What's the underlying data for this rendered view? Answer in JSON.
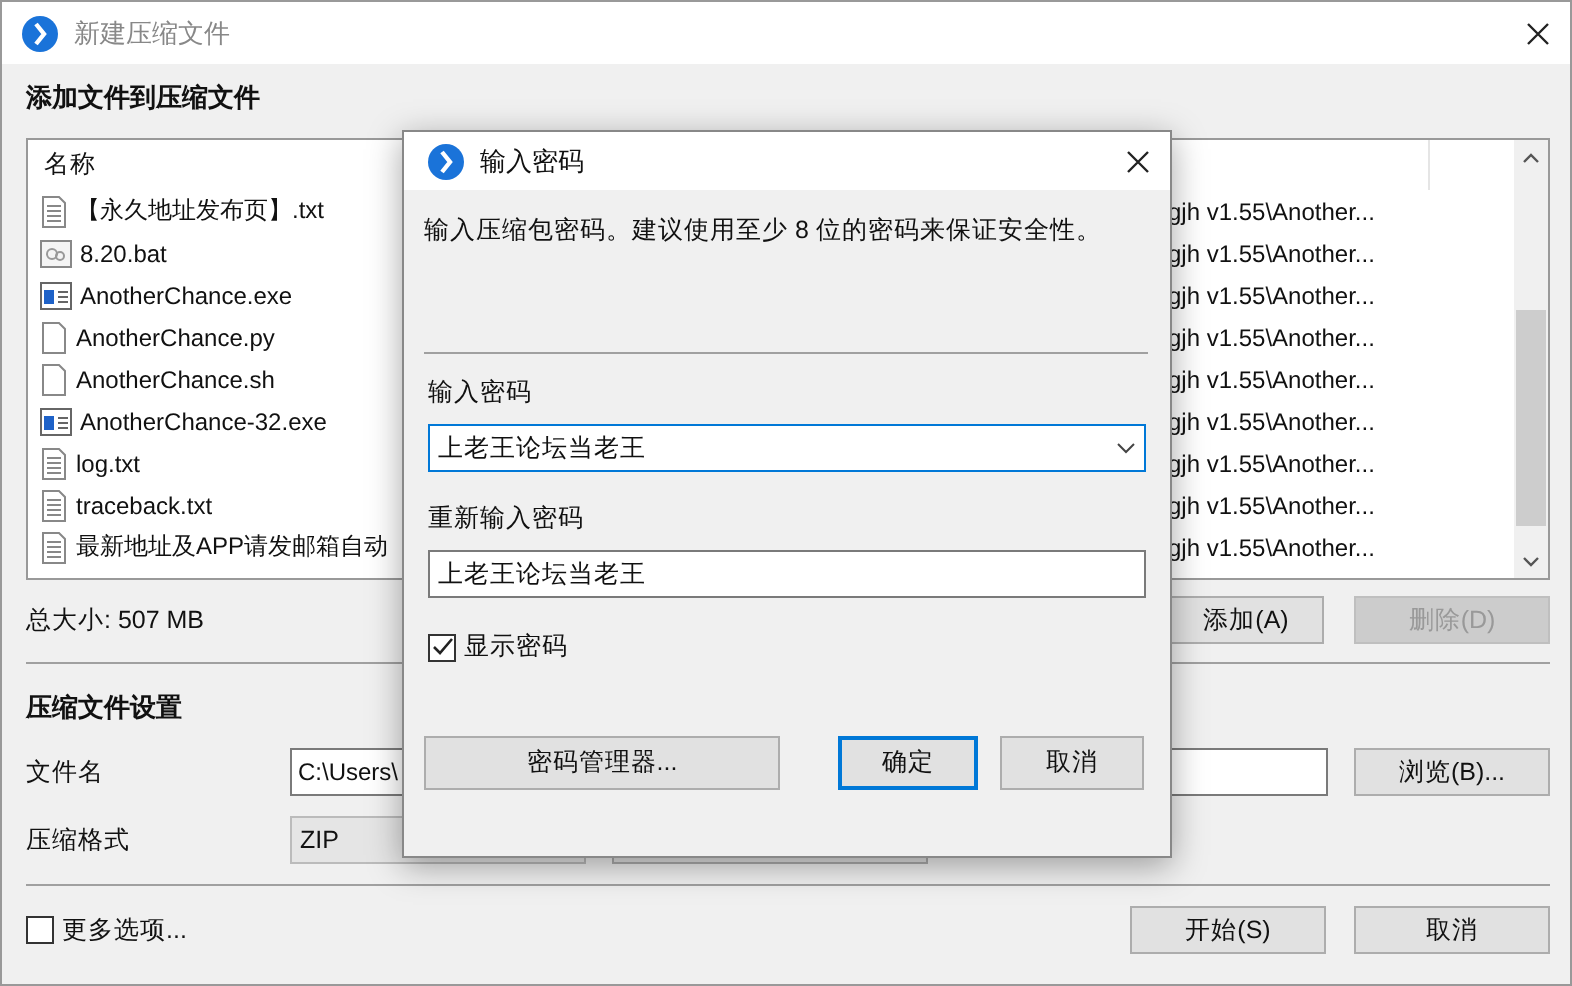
{
  "window": {
    "title": "新建压缩文件"
  },
  "add_section": {
    "heading": "添加文件到压缩文件",
    "file_list": {
      "columns": [
        "名称"
      ],
      "rows": [
        {
          "name": "【永久地址发布页】.txt",
          "kind": "text",
          "path": "gjh v1.55\\Another..."
        },
        {
          "name": "8.20.bat",
          "kind": "batch",
          "path": "gjh v1.55\\Another..."
        },
        {
          "name": "AnotherChance.exe",
          "kind": "program",
          "path": "gjh v1.55\\Another..."
        },
        {
          "name": "AnotherChance.py",
          "kind": "blank",
          "path": "gjh v1.55\\Another..."
        },
        {
          "name": "AnotherChance.sh",
          "kind": "blank",
          "path": "gjh v1.55\\Another..."
        },
        {
          "name": "AnotherChance-32.exe",
          "kind": "program",
          "path": "gjh v1.55\\Another..."
        },
        {
          "name": "log.txt",
          "kind": "text",
          "path": "gjh v1.55\\Another..."
        },
        {
          "name": "traceback.txt",
          "kind": "text",
          "path": "gjh v1.55\\Another..."
        },
        {
          "name": "最新地址及APP请发邮箱自动",
          "kind": "text",
          "path": "gjh v1.55\\Another..."
        }
      ]
    },
    "total_size": "总大小: 507 MB",
    "buttons": [
      {
        "label": "添加(A)",
        "disabled": false
      },
      {
        "label": "删除(D)",
        "disabled": true
      }
    ]
  },
  "settings": {
    "heading": "压缩文件设置",
    "filename": {
      "label": "文件名",
      "value": "C:\\Users\\"
    },
    "browse_button": "浏览(B)...",
    "format": {
      "label": "压缩格式",
      "value": "ZIP"
    }
  },
  "more_options": {
    "label": "更多选项...",
    "checked": false
  },
  "footer_buttons": [
    "开始(S)",
    "取消"
  ],
  "dialog": {
    "title": "输入密码",
    "hint": "输入压缩包密码。建议使用至少 8 位的密码来保证安全性。",
    "password": {
      "label": "输入密码",
      "value": "上老王论坛当老王"
    },
    "confirm": {
      "label": "重新输入密码",
      "value": "上老王论坛当老王"
    },
    "show_password": {
      "label": "显示密码",
      "checked": true
    },
    "manager_button": "密码管理器...",
    "buttons": [
      {
        "label": "确定",
        "default": true
      },
      {
        "label": "取消",
        "default": false
      }
    ]
  }
}
